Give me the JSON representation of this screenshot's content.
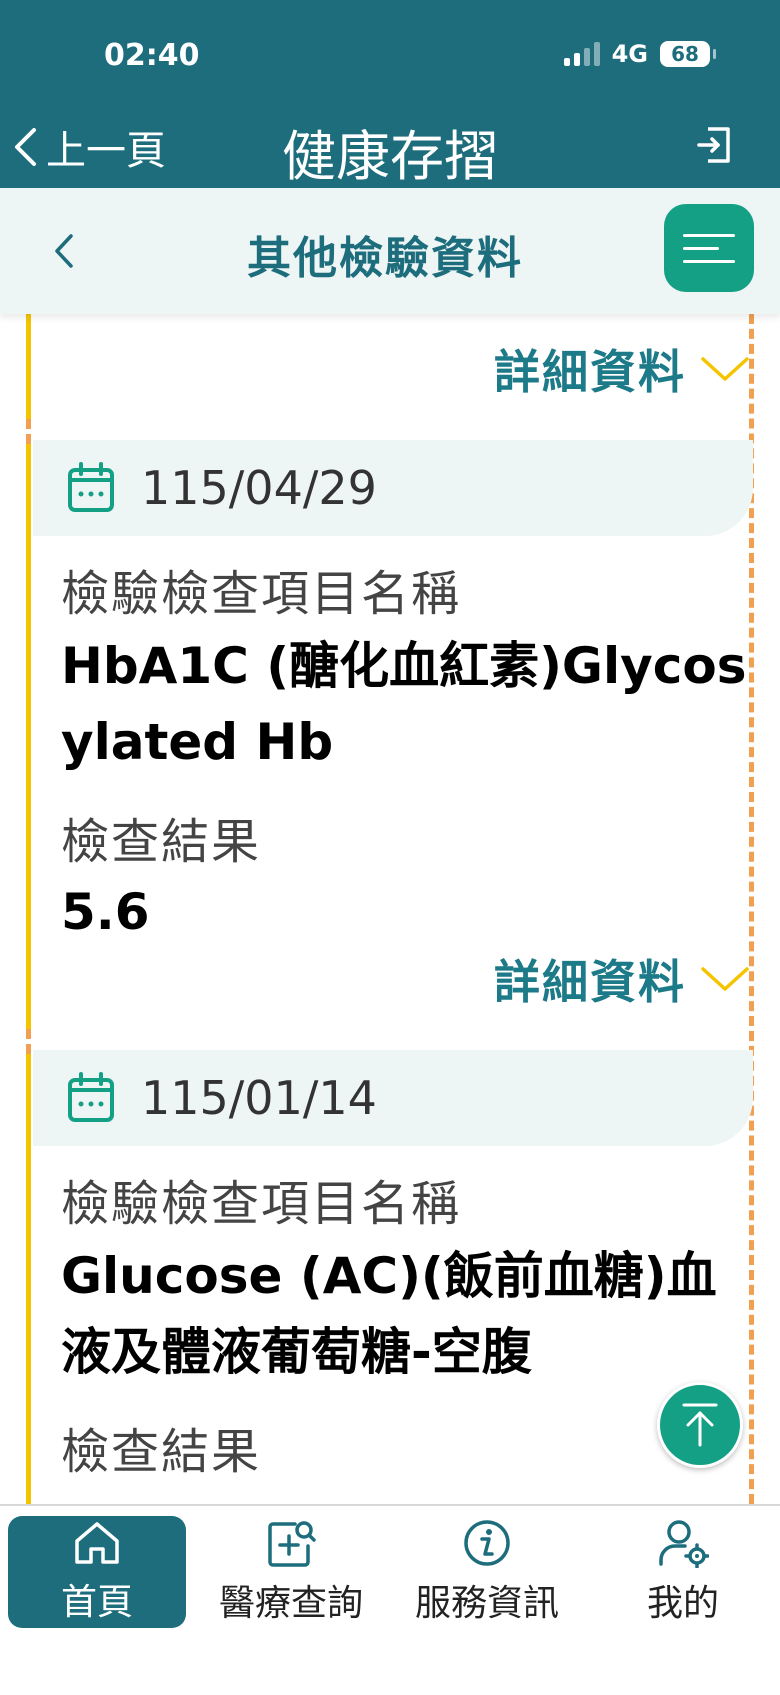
{
  "status_bar": {
    "time": "02:40",
    "network": "4G",
    "battery": "68"
  },
  "header": {
    "back_label": "上一頁",
    "title": "健康存摺"
  },
  "subheader": {
    "title": "其他檢驗資料"
  },
  "detail_link_label": "詳細資料",
  "records": [
    {
      "date": "115/04/29",
      "item_label": "檢驗檢查項目名稱",
      "item_name": "HbA1C (醣化血紅素)Glycosylated Hb",
      "result_label": "檢查結果",
      "result_value": "5.6"
    },
    {
      "date": "115/01/14",
      "item_label": "檢驗檢查項目名稱",
      "item_name": "Glucose (AC)(飯前血糖)血液及體液葡萄糖-空腹",
      "result_label": "檢查結果"
    }
  ],
  "bottom_nav": [
    {
      "label": "首頁",
      "icon": "home-icon",
      "active": true
    },
    {
      "label": "醫療查詢",
      "icon": "medical-search-icon",
      "active": false
    },
    {
      "label": "服務資訊",
      "icon": "info-icon",
      "active": false
    },
    {
      "label": "我的",
      "icon": "user-settings-icon",
      "active": false
    }
  ],
  "colors": {
    "header": "#1d6d7d",
    "accent": "#14a085",
    "link": "#1d7a88",
    "dash": "#f0a050",
    "bar": "#f5c400"
  }
}
